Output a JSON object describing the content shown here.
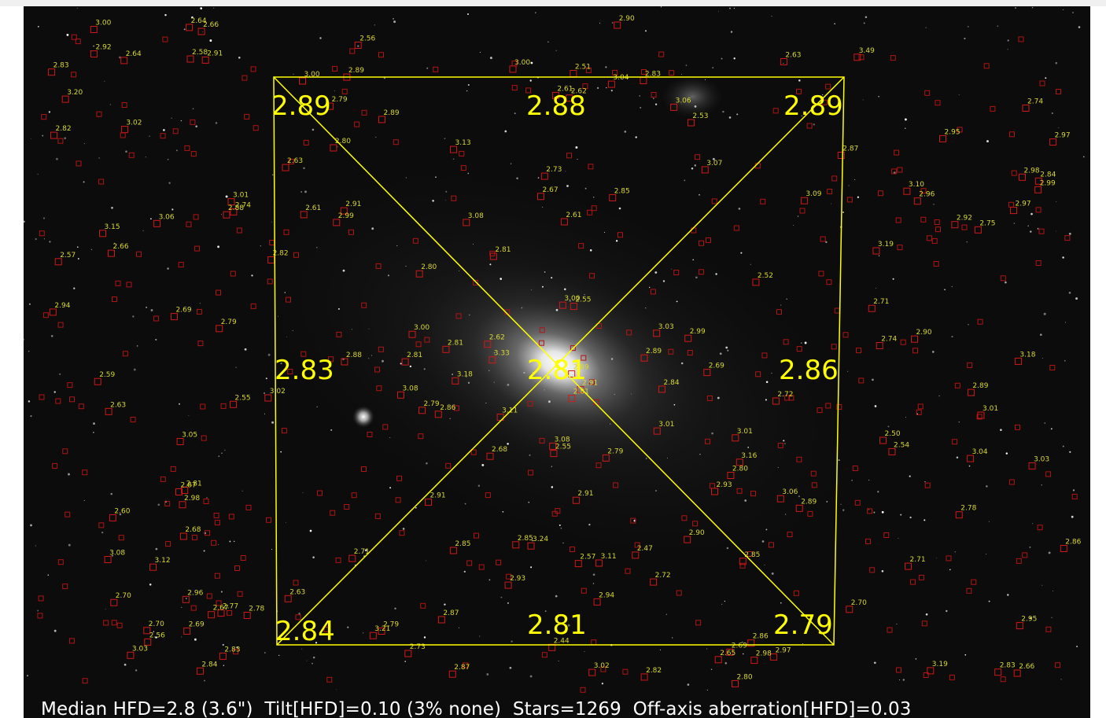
{
  "status": {
    "median_hfd": "Median HFD=2.8 (3.6\")",
    "tilt": "Tilt[HFD]=0.10 (3% none)",
    "stars": "Stars=1269",
    "off_axis": "Off-axis aberration[HFD]=0.03"
  },
  "regions": {
    "top_left": "2.89",
    "top_center": "2.88",
    "top_right": "2.89",
    "mid_left": "2.83",
    "center": "2.81",
    "mid_right": "2.86",
    "bottom_left": "2.84",
    "bottom_center": "2.81",
    "bottom_right": "2.79"
  },
  "star_hfd_labels": [
    "3.02",
    "3.15",
    "2.61",
    "2.81",
    "2.87",
    "3.21",
    "2.69",
    "3.05",
    "2.63",
    "3.02",
    "2.44",
    "3.03",
    "2.82",
    "2.79",
    "2.63",
    "2.84",
    "2.89",
    "2.66",
    "2.85",
    "2.90",
    "2.84",
    "2.52",
    "3.08",
    "3.20",
    "2.97",
    "3.19",
    "2.90",
    "2.97",
    "2.56",
    "2.91",
    "3.06",
    "2.89",
    "3.00",
    "2.79",
    "2.83",
    "3.03",
    "2.63",
    "2.99",
    "3.00",
    "2.65",
    "2.78",
    "2.87",
    "2.74",
    "2.98",
    "3.11",
    "3.00",
    "2.86",
    "3.06",
    "2.62",
    "3.03",
    "2.85",
    "3.11",
    "2.88",
    "3.01",
    "2.72",
    "2.85",
    "3.49",
    "2.80",
    "3.18",
    "3.33",
    "3.19",
    "2.68",
    "2.74",
    "2.69",
    "2.79",
    "2.91",
    "2.97",
    "2.96",
    "2.89",
    "3.01",
    "2.82",
    "2.87",
    "3.06",
    "2.83",
    "2.92",
    "2.83",
    "2.69",
    "2.81",
    "2.62",
    "2.74",
    "3.00",
    "2.55",
    "2.95",
    "2.71",
    "2.70",
    "3.18",
    "2.95",
    "3.01",
    "2.91",
    "2.94",
    "2.89",
    "2.90",
    "3.07",
    "2.79",
    "2.92",
    "2.81",
    "3.16",
    "2.96",
    "2.73",
    "2.94",
    "3.02",
    "2.89",
    "2.75",
    "2.99",
    "2.70",
    "3.01",
    "2.86",
    "2.81",
    "2.93",
    "3.09",
    "3.08",
    "2.77",
    "3.12",
    "3.04",
    "2.89",
    "2.69",
    "2.87",
    "2.78",
    "2.67",
    "2.84",
    "2.80",
    "2.51",
    "2.98",
    "3.08",
    "2.57",
    "2.71",
    "2.80",
    "2.55",
    "2.91",
    "3.24",
    "3.10",
    "2.61",
    "2.66",
    "2.50",
    "2.93",
    "3.00",
    "2.70",
    "2.64",
    "2.61",
    "2.66",
    "2.67",
    "2.54",
    "2.57",
    "2.86",
    "2.73",
    "2.99",
    "2.83",
    "2.81",
    "2.82",
    "2.53",
    "3.13",
    "2.64",
    "2.68",
    "2.47",
    "2.59",
    "2.85",
    "2.88",
    "2.91",
    "2.98",
    "3.04",
    "2.55",
    "2.71",
    "2.72",
    "2.60",
    "3.08",
    "2.63",
    "2.79",
    "2.80",
    "2.56",
    "2.58"
  ]
}
